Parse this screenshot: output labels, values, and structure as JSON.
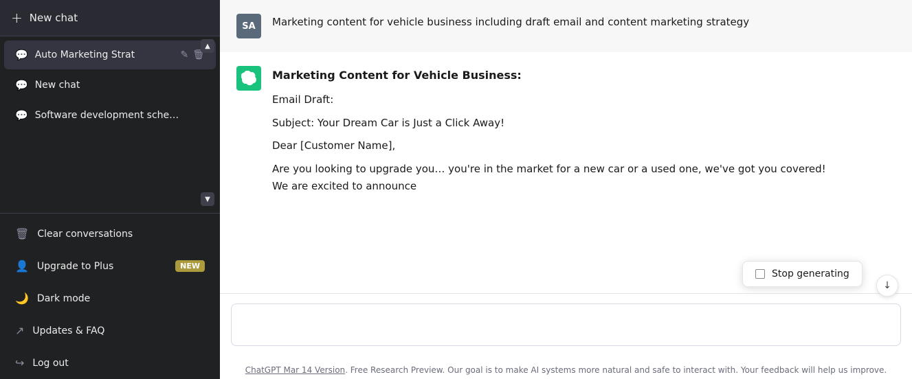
{
  "sidebar": {
    "new_chat_label": "New chat",
    "plus_icon": "+",
    "scroll_up_icon": "▲",
    "scroll_down_icon": "▼",
    "chat_items": [
      {
        "id": "auto-marketing",
        "label": "Auto Marketing Strat",
        "active": true,
        "edit_icon": "✎",
        "delete_icon": "🗑"
      },
      {
        "id": "new-chat",
        "label": "New chat",
        "active": false
      },
      {
        "id": "software-dev",
        "label": "Software development sche…",
        "active": false
      }
    ],
    "bottom_items": [
      {
        "id": "clear-conversations",
        "label": "Clear conversations",
        "icon": "trash"
      },
      {
        "id": "upgrade-to-plus",
        "label": "Upgrade to Plus",
        "icon": "person",
        "badge": "NEW"
      },
      {
        "id": "dark-mode",
        "label": "Dark mode",
        "icon": "moon"
      },
      {
        "id": "updates-faq",
        "label": "Updates & FAQ",
        "icon": "external-link"
      },
      {
        "id": "log-out",
        "label": "Log out",
        "icon": "logout"
      }
    ]
  },
  "main": {
    "user_message": {
      "avatar": "SA",
      "text": "Marketing content for vehicle business including draft email and content marketing strategy"
    },
    "ai_message": {
      "heading": "Marketing Content for Vehicle Business:",
      "email_draft_label": "Email Draft:",
      "subject_line": "Subject: Your Dream Car is Just a Click Away!",
      "salutation": "Dear [Customer Name],",
      "body": "Are you looking to upgrade you… you're in the market for a new car or a used one, we've got you covered! We are excited to announce"
    },
    "stop_generating": {
      "label": "Stop generating"
    },
    "input_placeholder": "",
    "footer_link_text": "ChatGPT Mar 14 Version",
    "footer_text": ". Free Research Preview. Our goal is to make AI systems more natural and safe to interact with. Your feedback will help us improve.",
    "scroll_down_icon": "⌄"
  }
}
